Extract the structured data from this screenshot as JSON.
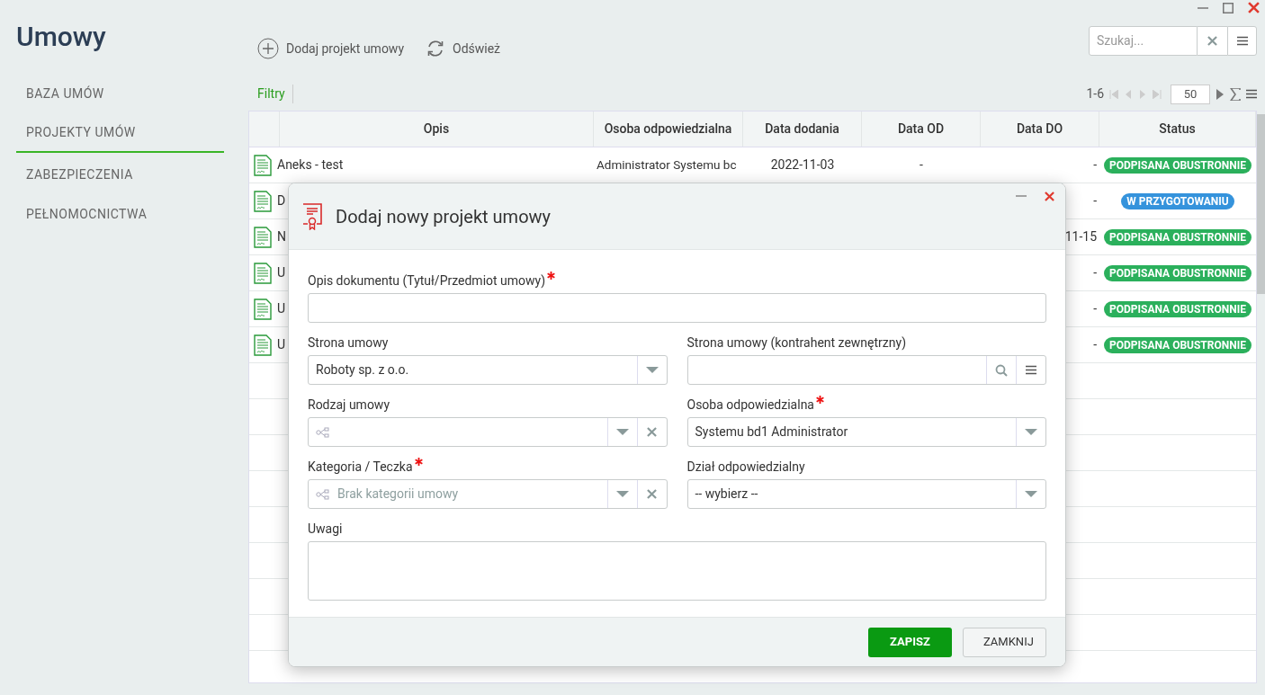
{
  "app": {
    "title": "Umowy"
  },
  "sidebar": {
    "items": [
      {
        "label": "BAZA UMÓW",
        "selected": false
      },
      {
        "label": "PROJEKTY UMÓW",
        "selected": true
      },
      {
        "label": "ZABEZPIECZENIA",
        "selected": false
      },
      {
        "label": "PEŁNOMOCNICTWA",
        "selected": false
      }
    ]
  },
  "toolbar": {
    "buttons": [
      {
        "label": "Dodaj projekt umowy",
        "kind": "add"
      },
      {
        "label": "Odśwież",
        "kind": "refresh"
      }
    ],
    "search": {
      "placeholder": "Szukaj..."
    }
  },
  "filters": {
    "label": "Filtry"
  },
  "pagination": {
    "range": "1-6",
    "page_size": "50"
  },
  "table": {
    "columns": [
      "Opis",
      "Osoba odpowiedzialna",
      "Data dodania",
      "Data OD",
      "Data DO",
      "Status"
    ],
    "rows": [
      {
        "opis": "Aneks - test",
        "osoba": "Administrator Systemu bc",
        "data_dodania": "2022-11-03",
        "data_od": "-",
        "data_do": "-",
        "status": {
          "label": "PODPISANA OBUSTRONNIE",
          "color": "#2bb05c"
        }
      },
      {
        "opis": "D",
        "data_do": "-",
        "status": {
          "label": "W PRZYGOTOWANIU",
          "color": "#3593dc"
        }
      },
      {
        "opis": "N",
        "data_do": "11-15",
        "status": {
          "label": "PODPISANA OBUSTRONNIE",
          "color": "#2bb05c"
        }
      },
      {
        "opis": "U",
        "data_do": "-",
        "status": {
          "label": "PODPISANA OBUSTRONNIE",
          "color": "#2bb05c"
        }
      },
      {
        "opis": "U",
        "data_do": "-",
        "status": {
          "label": "PODPISANA OBUSTRONNIE",
          "color": "#2bb05c"
        }
      },
      {
        "opis": "U",
        "data_do": "-",
        "status": {
          "label": "PODPISANA OBUSTRONNIE",
          "color": "#2bb05c"
        }
      }
    ]
  },
  "modal": {
    "title": "Dodaj nowy projekt umowy",
    "fields": [
      {
        "label": "Opis dokumentu (Tytuł/Przedmiot umowy)",
        "required": true,
        "kind": "text"
      },
      {
        "label": "Strona umowy",
        "required": false,
        "kind": "select",
        "value": "Roboty sp. z o.o."
      },
      {
        "label": "Strona umowy (kontrahent zewnętrzny)",
        "required": false,
        "kind": "lookup"
      },
      {
        "label": "Rodzaj umowy",
        "required": false,
        "kind": "tree"
      },
      {
        "label": "Osoba odpowiedzialna",
        "required": true,
        "kind": "select",
        "value": "Systemu bd1 Administrator"
      },
      {
        "label": "Kategoria / Teczka",
        "required": true,
        "kind": "tree",
        "placeholder": "Brak kategorii umowy"
      },
      {
        "label": "Dział odpowiedzialny",
        "required": false,
        "kind": "select",
        "value": "-- wybierz --"
      },
      {
        "label": "Uwagi",
        "required": false,
        "kind": "textarea"
      }
    ],
    "buttons": [
      {
        "label": "ZAPISZ",
        "kind": "primary"
      },
      {
        "label": "ZAMKNIJ",
        "kind": "secondary"
      }
    ]
  }
}
